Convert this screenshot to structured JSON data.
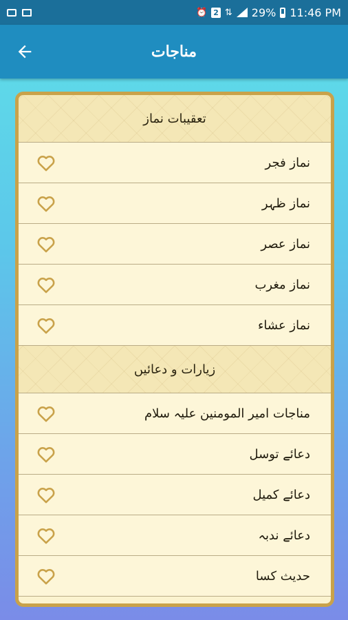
{
  "status_bar": {
    "left_icons": [
      "laptop-icon",
      "mail-icon"
    ],
    "alarm": "⏰",
    "badge": "2",
    "signal_text": "⇅",
    "battery_percent": "29%",
    "time": "11:46 PM"
  },
  "appbar": {
    "title": "مناجات",
    "back_icon": "arrow-left-icon"
  },
  "list": {
    "section1": "تعقیبات نماز",
    "section1_items": [
      "نماز فجر",
      "نماز ظہر",
      "نماز عصر",
      "نماز مغرب",
      "نماز عشاء"
    ],
    "section2": "زیارات و دعائیں",
    "section2_items": [
      "مناجات امیر المومنین علیہ سلام",
      "دعائے توسل",
      "دعائے کمیل",
      "دعائے ندبہ",
      "حدیث کسا"
    ]
  },
  "colors": {
    "appbar": "#1f8dc0",
    "card_border": "#c9a24a",
    "card_bg": "#fbf3cf",
    "heart": "#c9a24a"
  }
}
